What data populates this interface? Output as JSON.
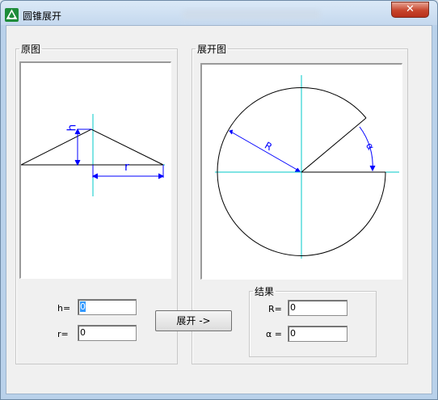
{
  "window": {
    "title": "圆锥展开",
    "close_glyph": "✕"
  },
  "left_group": {
    "label": "原图",
    "dim_h": "h",
    "dim_r": "r"
  },
  "right_group": {
    "label": "展开图",
    "dim_R": "R",
    "dim_alpha": "α"
  },
  "inputs": {
    "h_label": "h=",
    "h_value": "0",
    "r_label": "r=",
    "r_value": "0"
  },
  "expand_button": "展开 ->",
  "result": {
    "label": "结果",
    "R_label": "R=",
    "R_value": "0",
    "alpha_label": "α =",
    "alpha_value": "0"
  },
  "colors": {
    "axis": "#00c8c8",
    "dimension": "#0000ff",
    "line": "#000000",
    "selection": "#3399ff"
  },
  "icons": {
    "app": "cone-app-icon",
    "close": "close-icon"
  }
}
